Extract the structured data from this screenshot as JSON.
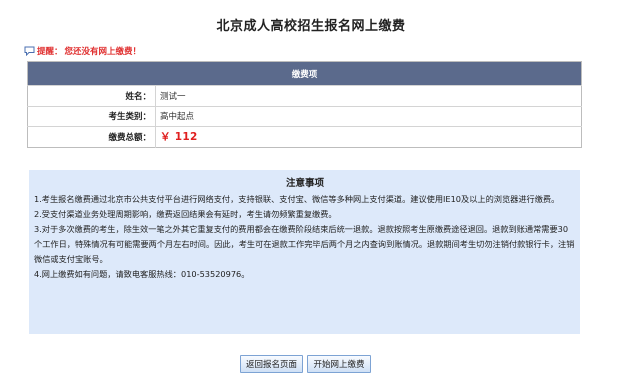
{
  "page": {
    "title": "北京成人高校招生报名网上缴费"
  },
  "reminder": {
    "label": "提醒：",
    "text": "您还没有网上缴费！"
  },
  "fee_table": {
    "header": "缴费项",
    "rows": [
      {
        "label": "姓名：",
        "value": "测试一"
      },
      {
        "label": "考生类别：",
        "value": "高中起点"
      },
      {
        "label": "缴费总额：",
        "value": "￥ 112"
      }
    ]
  },
  "notice": {
    "title": "注意事项",
    "items": [
      "1.考生报名缴费通过北京市公共支付平台进行网络支付，支持银联、支付宝、微信等多种网上支付渠道。建议使用IE10及以上的浏览器进行缴费。",
      "2.受支付渠道业务处理周期影响，缴费返回结果会有延时，考生请勿频繁重复缴费。",
      "3.对于多次缴费的考生，除生效一笔之外其它重复支付的费用都会在缴费阶段结束后统一退款。退款按照考生原缴费途径退回。退款到账通常需要30个工作日，特殊情况有可能需要两个月左右时间。因此，考生可在退款工作完毕后两个月之内查询到账情况。退款期间考生切勿注销付款银行卡，注销微信或支付宝账号。",
      "4.网上缴费如有问题，请致电客服热线：010-53520976。"
    ]
  },
  "buttons": {
    "back": "返回报名页面",
    "pay": "开始网上缴费"
  },
  "colors": {
    "header_bg": "#5b6a8c",
    "notice_bg": "#dde9fa",
    "alert_red": "#e01f1f"
  },
  "icons": {
    "reminder": "speech-bubble-icon"
  }
}
